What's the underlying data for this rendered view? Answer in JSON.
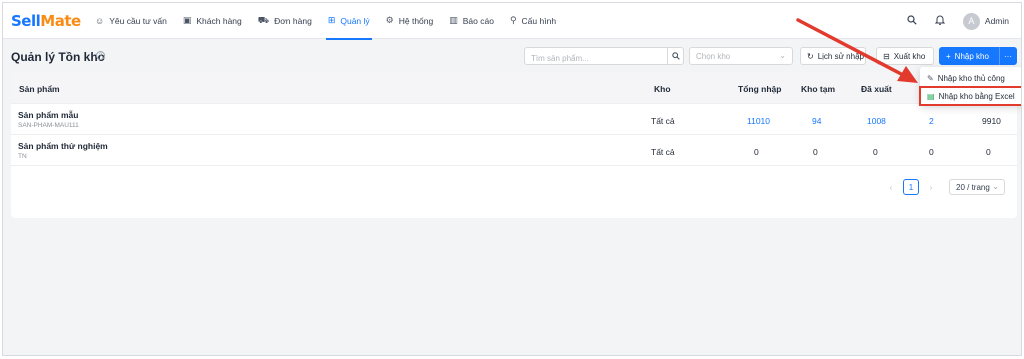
{
  "brand": {
    "part1": "Sell",
    "part2": "Mate"
  },
  "nav": [
    {
      "label": "Yêu cầu tư vấn",
      "icon": "chat-icon"
    },
    {
      "label": "Khách hàng",
      "icon": "contact-card-icon"
    },
    {
      "label": "Đơn hàng",
      "icon": "cart-icon"
    },
    {
      "label": "Quản lý",
      "icon": "grid-icon",
      "active": true
    },
    {
      "label": "Hệ thống",
      "icon": "gear-icon"
    },
    {
      "label": "Báo cáo",
      "icon": "bar-chart-icon"
    },
    {
      "label": "Cấu hình",
      "icon": "wrench-icon"
    }
  ],
  "user": {
    "name": "Admin",
    "initial": "A"
  },
  "page": {
    "title": "Quản lý Tồn kho",
    "search_placeholder": "Tìm sản phẩm...",
    "warehouse_placeholder": "Chọn kho",
    "history_label": "Lịch sử nhập",
    "export_label": "Xuất kho",
    "import_label": "Nhập kho"
  },
  "table": {
    "columns": [
      "Sản phẩm",
      "Kho",
      "Tổng nhập",
      "Kho tạm",
      "Đã xuất"
    ],
    "rows": [
      {
        "name": "Sản phẩm mẫu",
        "sku": "SAN-PHAM-MAU111",
        "warehouse": "Tất cả",
        "total_in": "11010",
        "temp": "94",
        "out": "1008",
        "col6": "2",
        "col7": "9910"
      },
      {
        "name": "Sản phẩm thử nghiệm",
        "sku": "TN",
        "warehouse": "Tất cả",
        "total_in": "0",
        "temp": "0",
        "out": "0",
        "col6": "0",
        "col7": "0"
      }
    ]
  },
  "pagination": {
    "current": "1",
    "page_size": "20 / trang"
  },
  "dropdown": {
    "items": [
      {
        "label": "Nhập kho thủ công",
        "icon": "edit-icon"
      },
      {
        "label": "Nhập kho bằng Excel",
        "icon": "excel-file-icon",
        "highlighted": true
      }
    ]
  },
  "colors": {
    "primary": "#1677ff",
    "brand_orange": "#fa8c16",
    "highlight_red": "#e23b2e"
  }
}
